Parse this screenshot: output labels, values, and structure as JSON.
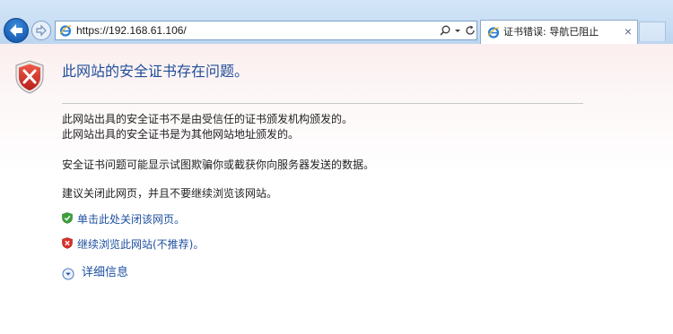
{
  "browser": {
    "address_url": "https://192.168.61.106/",
    "tab_title": "证书错误: 导航已阻止",
    "tab_close": "×"
  },
  "page": {
    "title": "此网站的安全证书存在问题。",
    "paragraph1_line1": "此网站出具的安全证书不是由受信任的证书颁发机构颁发的。",
    "paragraph1_line2": "此网站出具的安全证书是为其他网站地址颁发的。",
    "paragraph2": "安全证书问题可能显示试图欺骗你或截获你向服务器发送的数据。",
    "paragraph3": "建议关闭此网页，并且不要继续浏览该网站。",
    "close_link": "单击此处关闭该网页。",
    "continue_link": "继续浏览此网站(不推荐)。",
    "more_info": "详细信息"
  },
  "icons": {
    "back": "back-arrow-icon",
    "forward": "forward-arrow-icon",
    "ie": "ie-logo-icon",
    "search": "search-icon",
    "dropdown": "chevron-down-icon",
    "refresh": "refresh-icon",
    "error_shield": "error-shield-icon",
    "safe_shield": "green-shield-icon",
    "unsafe_shield": "red-shield-icon",
    "expand": "expand-circle-icon"
  },
  "colors": {
    "link": "#1e50a0",
    "title": "#1f4e9a",
    "chrome": "#c7ddf4",
    "error_red": "#d9302a"
  }
}
